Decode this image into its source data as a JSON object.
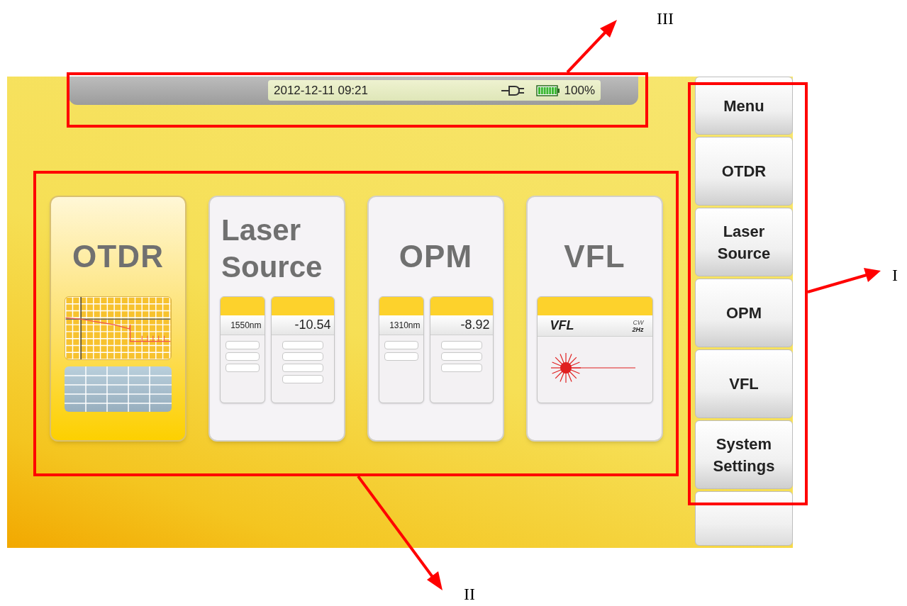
{
  "status_bar": {
    "datetime": "2012-12-11 09:21",
    "battery": "100%"
  },
  "modules": [
    {
      "kind": "otdr",
      "title": "OTDR",
      "selected": true
    },
    {
      "kind": "meter",
      "title": "Laser Source",
      "selected": false,
      "wavelength": "1550nm",
      "value": "-10.54"
    },
    {
      "kind": "meter",
      "title": "OPM",
      "selected": false,
      "wavelength": "1310nm",
      "value": "-8.92"
    },
    {
      "kind": "vfl",
      "title": "VFL",
      "selected": false,
      "label": "VFL",
      "mode": "CW",
      "frequency": "2Hz"
    }
  ],
  "sidebar": {
    "items": [
      {
        "label": "Menu"
      },
      {
        "label": "OTDR"
      },
      {
        "label": "Laser Source"
      },
      {
        "label": "OPM"
      },
      {
        "label": "VFL"
      },
      {
        "label": "System Settings"
      }
    ]
  },
  "annotations": [
    {
      "label": "III"
    },
    {
      "label": "I"
    },
    {
      "label": "II"
    }
  ]
}
